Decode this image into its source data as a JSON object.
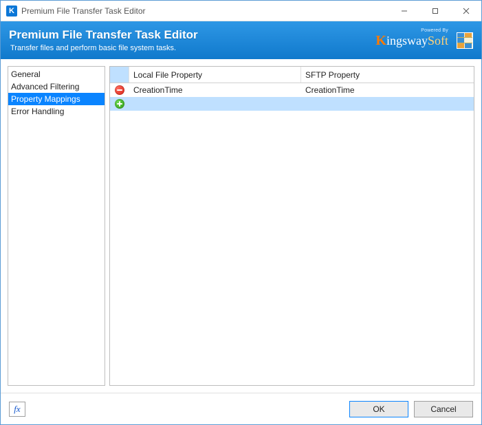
{
  "window": {
    "title": "Premium File Transfer Task Editor"
  },
  "header": {
    "title": "Premium File Transfer Task Editor",
    "subtitle": "Transfer files and perform basic file system tasks.",
    "brand_powered": "Powered By",
    "brand_name_k": "K",
    "brand_name_mid": "ingsway",
    "brand_name_soft": "Soft"
  },
  "sidebar": {
    "items": [
      {
        "label": "General",
        "selected": false
      },
      {
        "label": "Advanced Filtering",
        "selected": false
      },
      {
        "label": "Property Mappings",
        "selected": true
      },
      {
        "label": "Error Handling",
        "selected": false
      }
    ]
  },
  "grid": {
    "columns": {
      "col1": "Local File Property",
      "col2": "SFTP Property"
    },
    "rows": [
      {
        "icon": "remove",
        "col1": "CreationTime",
        "col2": "CreationTime",
        "highlight": false
      },
      {
        "icon": "add",
        "col1": "",
        "col2": "",
        "highlight": true
      }
    ]
  },
  "footer": {
    "fx_label": "fx",
    "ok": "OK",
    "cancel": "Cancel"
  }
}
